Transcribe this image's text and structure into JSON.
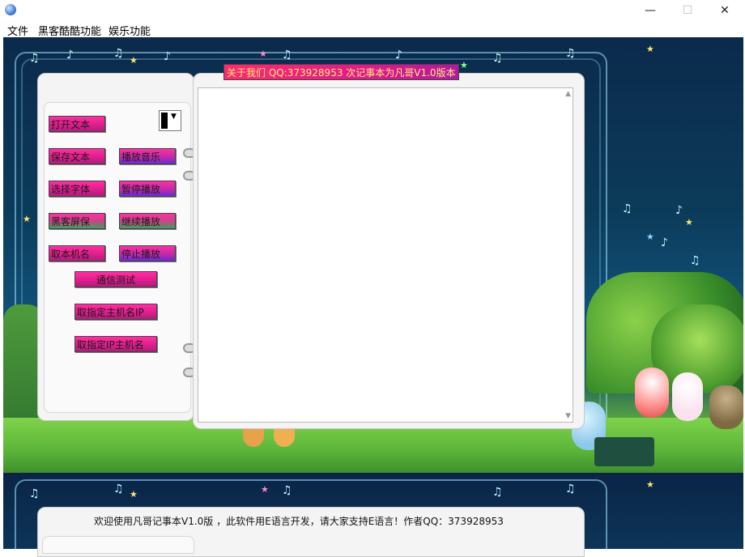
{
  "window": {
    "minimize_glyph": "—",
    "maximize_glyph": "☐",
    "close_glyph": "✕"
  },
  "menu": {
    "items": [
      "文件",
      "黑客酷酷功能",
      "娱乐功能"
    ]
  },
  "banner": {
    "text": "关于我们 QQ:373928953 次记事本为凡哥V1.0版本"
  },
  "buttons": {
    "open_text": "打开文本",
    "save_text": "保存文本",
    "play_music": "播放音乐",
    "select_font": "选择字体",
    "pause_play": "暂停播放",
    "hacker_screen": "黑客屏保",
    "resume_play": "继续播放",
    "get_hostname": "取本机名",
    "stop_play": "停止播放",
    "comm_test": "通信测试",
    "get_host_ip": "取指定主机名IP",
    "get_ip_host": "取指定IP主机名"
  },
  "editor": {
    "content": ""
  },
  "status": {
    "text": "欢迎使用凡哥记事本V1.0版 ，此软件用E语言开发，请大家支持E语言！作者QQ：373928953"
  },
  "colors": {
    "button_pink": "#e7218f",
    "banner_text": "#ffef7a",
    "night_sky": "#0b2a4c",
    "grass": "#6dbd3e"
  },
  "icons": {
    "app": "globe-icon",
    "dropdown": "chevron-down-icon"
  }
}
